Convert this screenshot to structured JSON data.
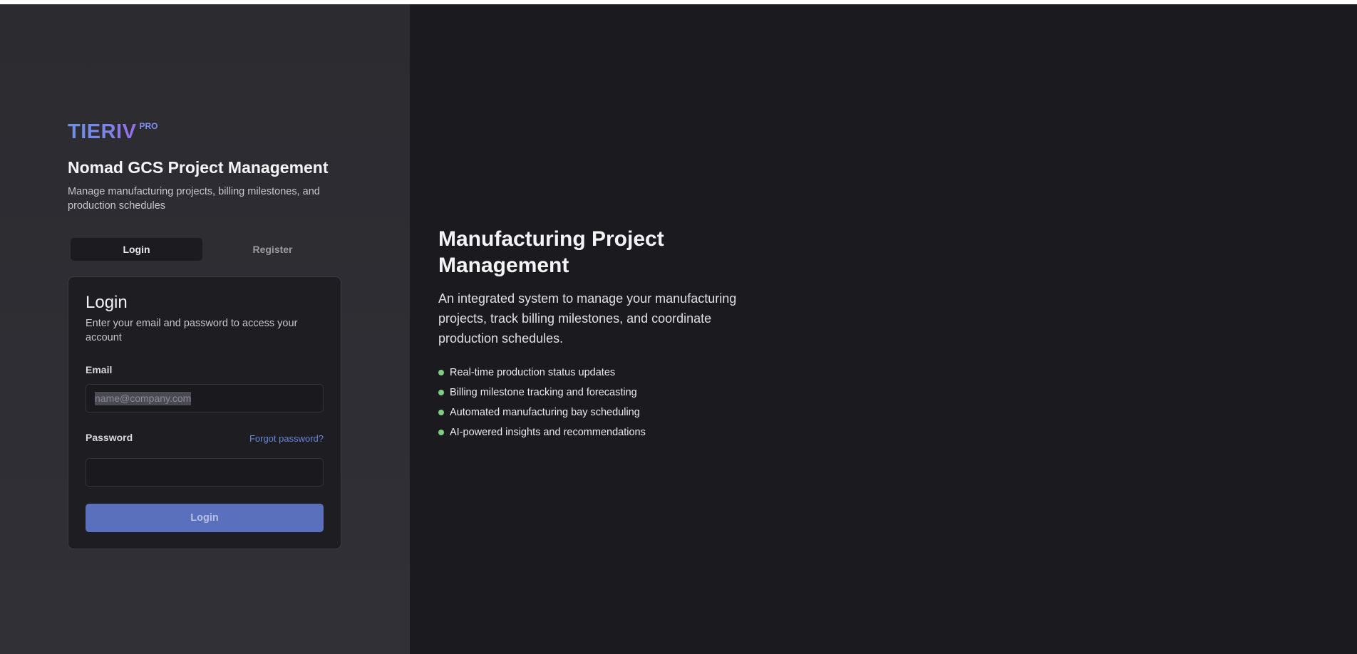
{
  "brand": {
    "name": "TIERIV",
    "badge": "PRO"
  },
  "header": {
    "title": "Nomad GCS Project Management",
    "subtitle": "Manage manufacturing projects, billing milestones, and production schedules"
  },
  "tabs": [
    {
      "label": "Login",
      "active": true
    },
    {
      "label": "Register",
      "active": false
    }
  ],
  "login_card": {
    "title": "Login",
    "description": "Enter your email and password to access your account",
    "email_label": "Email",
    "email_placeholder": "name@company.com",
    "password_label": "Password",
    "forgot_link": "Forgot password?",
    "submit_label": "Login"
  },
  "hero": {
    "title": "Manufacturing Project Management",
    "text": "An integrated system to manage your manufacturing projects, track billing milestones, and coordinate production schedules.",
    "features": [
      "Real-time production status updates",
      "Billing milestone tracking and forecasting",
      "Automated manufacturing bay scheduling",
      "AI-powered insights and recommendations"
    ]
  },
  "colors": {
    "accent": "#5b70bd",
    "link": "#6b86d8",
    "feature_dot": "#7fcf80",
    "left_panel": "#2e2e34",
    "right_panel": "#1b1b1f"
  },
  "icons": {
    "feature_bullet": "dot-icon"
  }
}
